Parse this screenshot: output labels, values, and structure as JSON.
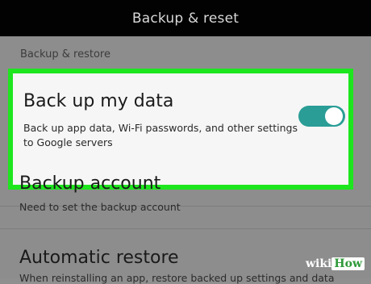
{
  "header": {
    "title": "Backup & reset"
  },
  "section": {
    "label": "Backup & restore"
  },
  "backup_data": {
    "title": "Back up my data",
    "description": "Back up app data, Wi-Fi passwords, and other settings to Google servers",
    "toggle_on": true
  },
  "backup_account": {
    "title": "Backup account",
    "subtitle": "Need to set the backup account"
  },
  "automatic_restore": {
    "title": "Automatic restore",
    "subtitle": "When reinstalling an app, restore backed up settings and data"
  },
  "watermark": {
    "part1": "wiki",
    "part2": "How"
  },
  "colors": {
    "highlight_border": "#1ee61e",
    "toggle_on": "#2a9d96",
    "title_bar": "#020202"
  }
}
